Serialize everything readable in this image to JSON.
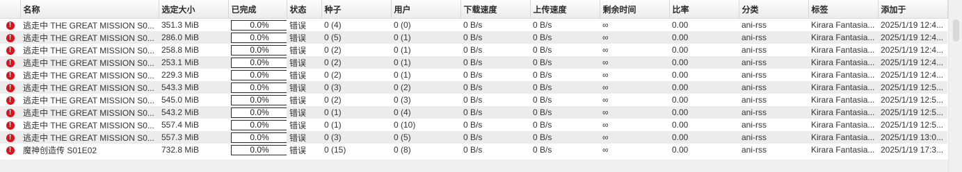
{
  "columns": [
    "",
    "名称",
    "选定大小",
    "已完成",
    "状态",
    "种子",
    "用户",
    "下载速度",
    "上传速度",
    "剩余时间",
    "比率",
    "分类",
    "标签",
    "添加于"
  ],
  "status_icon": "error-icon",
  "colors": {
    "error_icon": "#e0101a",
    "row_alt": "#ececec"
  },
  "rows": [
    {
      "name": "逃走中 THE GREAT MISSION S0...",
      "size": "351.3 MiB",
      "progress": "0.0%",
      "state": "错误",
      "seeds": "0 (4)",
      "peers": "0 (0)",
      "dl_speed": "0 B/s",
      "up_speed": "0 B/s",
      "eta": "∞",
      "ratio": "0.00",
      "category": "ani-rss",
      "tags": "Kirara Fantasia...",
      "added_on": "2025/1/19 12:4..."
    },
    {
      "name": "逃走中 THE GREAT MISSION S0...",
      "size": "286.0 MiB",
      "progress": "0.0%",
      "state": "错误",
      "seeds": "0 (5)",
      "peers": "0 (1)",
      "dl_speed": "0 B/s",
      "up_speed": "0 B/s",
      "eta": "∞",
      "ratio": "0.00",
      "category": "ani-rss",
      "tags": "Kirara Fantasia...",
      "added_on": "2025/1/19 12:4..."
    },
    {
      "name": "逃走中 THE GREAT MISSION S0...",
      "size": "258.8 MiB",
      "progress": "0.0%",
      "state": "错误",
      "seeds": "0 (2)",
      "peers": "0 (1)",
      "dl_speed": "0 B/s",
      "up_speed": "0 B/s",
      "eta": "∞",
      "ratio": "0.00",
      "category": "ani-rss",
      "tags": "Kirara Fantasia...",
      "added_on": "2025/1/19 12:4..."
    },
    {
      "name": "逃走中 THE GREAT MISSION S0...",
      "size": "253.1 MiB",
      "progress": "0.0%",
      "state": "错误",
      "seeds": "0 (2)",
      "peers": "0 (1)",
      "dl_speed": "0 B/s",
      "up_speed": "0 B/s",
      "eta": "∞",
      "ratio": "0.00",
      "category": "ani-rss",
      "tags": "Kirara Fantasia...",
      "added_on": "2025/1/19 12:4..."
    },
    {
      "name": "逃走中 THE GREAT MISSION S0...",
      "size": "229.3 MiB",
      "progress": "0.0%",
      "state": "错误",
      "seeds": "0 (2)",
      "peers": "0 (1)",
      "dl_speed": "0 B/s",
      "up_speed": "0 B/s",
      "eta": "∞",
      "ratio": "0.00",
      "category": "ani-rss",
      "tags": "Kirara Fantasia...",
      "added_on": "2025/1/19 12:4..."
    },
    {
      "name": "逃走中 THE GREAT MISSION S0...",
      "size": "543.3 MiB",
      "progress": "0.0%",
      "state": "错误",
      "seeds": "0 (3)",
      "peers": "0 (2)",
      "dl_speed": "0 B/s",
      "up_speed": "0 B/s",
      "eta": "∞",
      "ratio": "0.00",
      "category": "ani-rss",
      "tags": "Kirara Fantasia...",
      "added_on": "2025/1/19 12:5..."
    },
    {
      "name": "逃走中 THE GREAT MISSION S0...",
      "size": "545.0 MiB",
      "progress": "0.0%",
      "state": "错误",
      "seeds": "0 (2)",
      "peers": "0 (3)",
      "dl_speed": "0 B/s",
      "up_speed": "0 B/s",
      "eta": "∞",
      "ratio": "0.00",
      "category": "ani-rss",
      "tags": "Kirara Fantasia...",
      "added_on": "2025/1/19 12:5..."
    },
    {
      "name": "逃走中 THE GREAT MISSION S0...",
      "size": "543.2 MiB",
      "progress": "0.0%",
      "state": "错误",
      "seeds": "0 (1)",
      "peers": "0 (4)",
      "dl_speed": "0 B/s",
      "up_speed": "0 B/s",
      "eta": "∞",
      "ratio": "0.00",
      "category": "ani-rss",
      "tags": "Kirara Fantasia...",
      "added_on": "2025/1/19 12:5..."
    },
    {
      "name": "逃走中 THE GREAT MISSION S0...",
      "size": "557.4 MiB",
      "progress": "0.0%",
      "state": "错误",
      "seeds": "0 (1)",
      "peers": "0 (10)",
      "dl_speed": "0 B/s",
      "up_speed": "0 B/s",
      "eta": "∞",
      "ratio": "0.00",
      "category": "ani-rss",
      "tags": "Kirara Fantasia...",
      "added_on": "2025/1/19 12:5..."
    },
    {
      "name": "逃走中 THE GREAT MISSION S0...",
      "size": "557.3 MiB",
      "progress": "0.0%",
      "state": "错误",
      "seeds": "0 (3)",
      "peers": "0 (5)",
      "dl_speed": "0 B/s",
      "up_speed": "0 B/s",
      "eta": "∞",
      "ratio": "0.00",
      "category": "ani-rss",
      "tags": "Kirara Fantasia...",
      "added_on": "2025/1/19 13:0..."
    },
    {
      "name": "魔神创造传 S01E02",
      "size": "732.8 MiB",
      "progress": "0.0%",
      "state": "错误",
      "seeds": "0 (15)",
      "peers": "0 (8)",
      "dl_speed": "0 B/s",
      "up_speed": "0 B/s",
      "eta": "∞",
      "ratio": "0.00",
      "category": "ani-rss",
      "tags": "Kirara Fantasia...",
      "added_on": "2025/1/19 17:3..."
    }
  ]
}
